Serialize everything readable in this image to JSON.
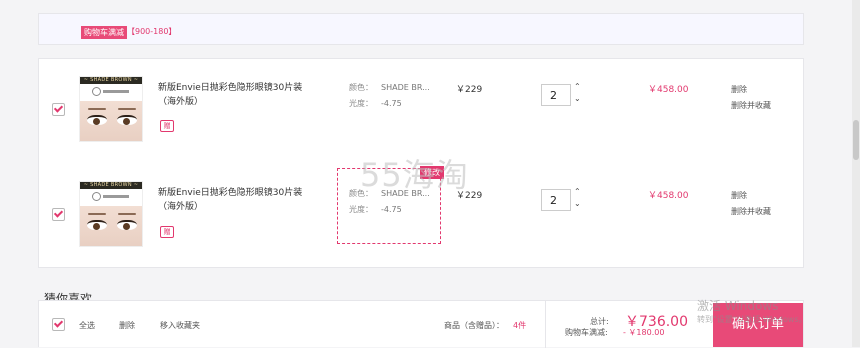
{
  "promo": {
    "tag": "购物车满减",
    "range": "【900-180】"
  },
  "items": [
    {
      "thumb_label": "~ SHADE BROWN ~",
      "title": "新版Envie日抛彩色隐形眼镜30片装（海外版）",
      "tag_icon": "赠",
      "color_label": "颜色：",
      "color_value": "SHADE BR...",
      "power_label": "光度：",
      "power_value": "-4.75",
      "price": "￥229",
      "quantity": "2",
      "subtotal": "￥458.00",
      "delete": "删除",
      "delete_and_save": "删除并收藏"
    },
    {
      "thumb_label": "~ SHADE BROWN ~",
      "title": "新版Envie日抛彩色隐形眼镜30片装（海外版）",
      "tag_icon": "赠",
      "color_label": "颜色：",
      "color_value": "SHADE BR...",
      "power_label": "光度：",
      "power_value": "-4.75",
      "price": "￥229",
      "quantity": "2",
      "subtotal": "￥458.00",
      "delete": "删除",
      "delete_and_save": "删除并收藏"
    }
  ],
  "edit_badge": "修改",
  "watermark": "55海淘",
  "guess": "猜你喜欢",
  "footer": {
    "select_all": "全选",
    "delete": "删除",
    "move_to_favorites": "移入收藏夹",
    "goods_label": "商品（含赠品）：",
    "goods_count": "4件",
    "total_label": "总计:",
    "total_amount": "￥736.00",
    "discount_label": "购物车满减:",
    "discount_amount": "- ￥180.00",
    "confirm": "确认订单"
  },
  "os_overlay": {
    "activate": "激活 Windows",
    "activate_hint": "转到\"设置\"以激活 Windows。"
  },
  "colors": {
    "accent": "#e2386e",
    "button": "#e84a78"
  }
}
